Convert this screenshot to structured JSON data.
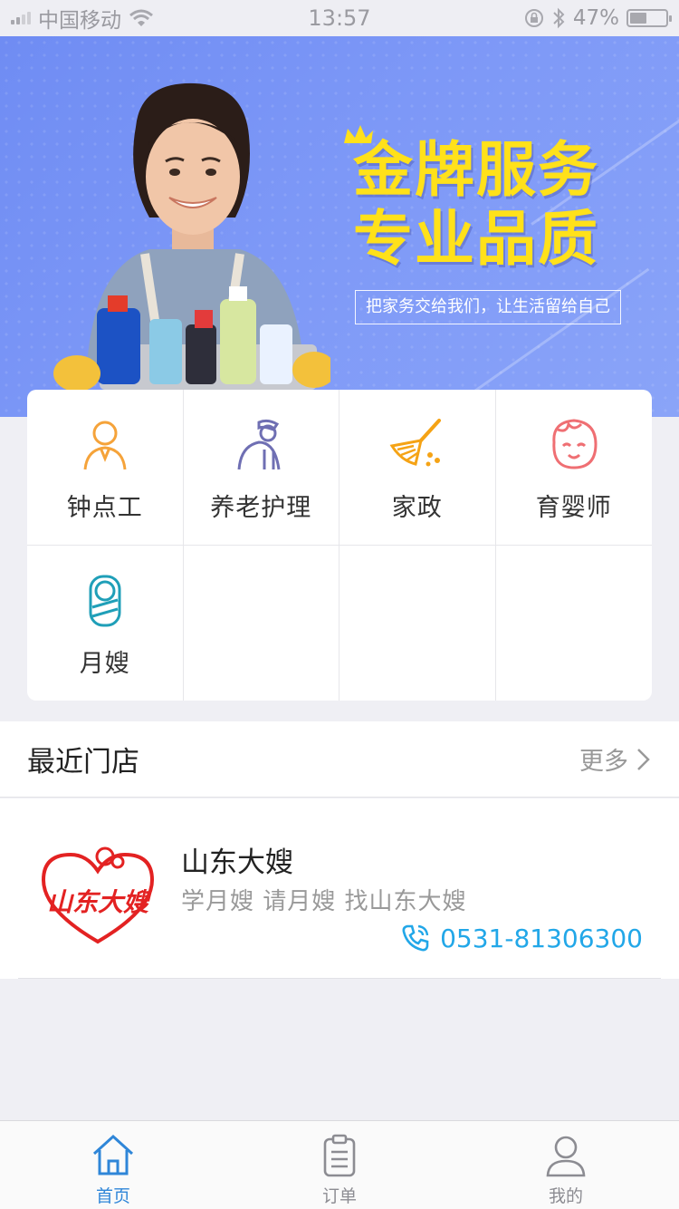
{
  "status_bar": {
    "carrier": "中国移动",
    "time": "13:57",
    "battery_percent": "47%",
    "battery_level": 0.47,
    "icons": [
      "signal-icon",
      "wifi-icon",
      "lock-rotation-icon",
      "bluetooth-icon",
      "battery-icon"
    ]
  },
  "banner": {
    "title_line1": "金牌服务",
    "title_line2": "专业品质",
    "slogan": "把家务交给我们，让生活留给自己",
    "page_count": 3,
    "active_page": 1,
    "colors": {
      "background": "#7b96f6",
      "title": "#ffe11a"
    }
  },
  "services": [
    {
      "label": "钟点工",
      "icon": "worker-icon",
      "color": "#f5a33a"
    },
    {
      "label": "养老护理",
      "icon": "elderly-care-icon",
      "color": "#6f6fb3"
    },
    {
      "label": "家政",
      "icon": "broom-icon",
      "color": "#f5a315"
    },
    {
      "label": "育婴师",
      "icon": "baby-face-icon",
      "color": "#ef6f73"
    },
    {
      "label": "月嫂",
      "icon": "swaddled-baby-icon",
      "color": "#1f9fb8"
    }
  ],
  "nearby": {
    "title": "最近门店",
    "more": "更多"
  },
  "store": {
    "name": "山东大嫂",
    "description": "学月嫂 请月嫂 找山东大嫂",
    "phone": "0531-81306300",
    "logo_text": "山东大嫂",
    "colors": {
      "logo": "#e32222",
      "phone": "#22a7e8"
    }
  },
  "tabbar": {
    "tabs": [
      {
        "label": "首页",
        "icon": "home-icon",
        "active": true
      },
      {
        "label": "订单",
        "icon": "clipboard-icon",
        "active": false
      },
      {
        "label": "我的",
        "icon": "user-icon",
        "active": false
      }
    ],
    "active_color": "#2f86d8"
  }
}
